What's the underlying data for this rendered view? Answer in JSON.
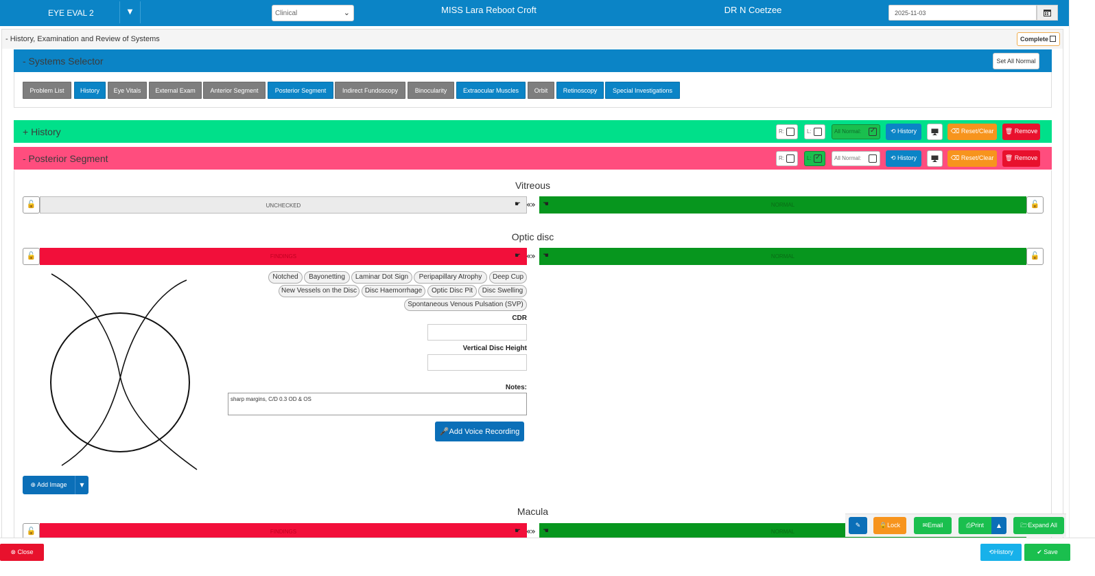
{
  "header": {
    "eval_name": "EYE EVAL 2",
    "encounter_type": "Clinical",
    "patient_name": "MISS Lara Reboot Croft",
    "doctor_name": "DR N Coetzee",
    "date": "2025-11-03"
  },
  "outer": {
    "title": "- History, Examination and Review of Systems",
    "complete_label": "Complete"
  },
  "systems_selector": {
    "title": "- Systems Selector",
    "set_all_normal": "Set All Normal",
    "buttons": [
      {
        "label": "Problem List",
        "state": "inactive"
      },
      {
        "label": "History",
        "state": "active"
      },
      {
        "label": "Eye Vitals",
        "state": "inactive"
      },
      {
        "label": "External Exam",
        "state": "inactive"
      },
      {
        "label": "Anterior Segment",
        "state": "inactive"
      },
      {
        "label": "Posterior Segment",
        "state": "active"
      },
      {
        "label": "Indirect Fundoscopy",
        "state": "inactive"
      },
      {
        "label": "Binocularity",
        "state": "inactive"
      },
      {
        "label": "Extraocular Muscles",
        "state": "active"
      },
      {
        "label": "Orbit",
        "state": "inactive"
      },
      {
        "label": "Retinoscopy",
        "state": "active"
      },
      {
        "label": "Special Investigations",
        "state": "active"
      }
    ]
  },
  "history_section": {
    "title": "+ History",
    "r_label": "R:",
    "l_label": "L:",
    "all_normal_label": "All Normal:",
    "r_checked": false,
    "l_checked": false,
    "all_normal_checked": true,
    "history_btn": "History",
    "reset_btn": "Reset/Clear",
    "remove_btn": "Remove"
  },
  "posterior_section": {
    "title": "- Posterior Segment",
    "r_label": "R:",
    "l_label": "L:",
    "all_normal_label": "All Normal:",
    "r_checked": false,
    "l_checked": true,
    "all_normal_checked": false,
    "history_btn": "History",
    "reset_btn": "Reset/Clear",
    "remove_btn": "Remove"
  },
  "vitreous": {
    "title": "Vitreous",
    "right_status": "UNCHECKED",
    "left_status": "NORMAL"
  },
  "optic_disc": {
    "title": "Optic disc",
    "right_status": "FINDINGS",
    "left_status": "NORMAL",
    "chips": [
      "Notched",
      "Bayonetting",
      "Laminar Dot Sign",
      "Peripapillary Atrophy",
      "Deep Cup",
      "New Vessels on the Disc",
      "Disc Haemorrhage",
      "Optic Disc Pit",
      "Disc Swelling",
      "Spontaneous Venous Pulsation (SVP)"
    ],
    "cdr_label": "CDR",
    "cdr_value": "",
    "vdh_label": "Vertical Disc Height",
    "vdh_value": "",
    "notes_label": "Notes:",
    "notes_value": "sharp margins, C/D 0.3 OD & OS",
    "voice_btn": "Add Voice Recording",
    "add_image_btn": "Add Image"
  },
  "macula": {
    "title": "Macula",
    "right_status": "FINDINGS",
    "left_status": "NORMAL"
  },
  "floating_toolbar": {
    "lock": "Lock",
    "email": "Email",
    "print": "Print",
    "expand_all": "Expand All"
  },
  "footer": {
    "close": "Close",
    "history": "History",
    "save": "Save"
  },
  "colors": {
    "primary_blue": "#0b84c6",
    "history_green": "#00e08a",
    "posterior_pink": "#ff4d7e",
    "findings_red": "#f20f3a",
    "normal_green": "#07961e",
    "orange": "#f7941d",
    "danger_red": "#e8112d"
  }
}
